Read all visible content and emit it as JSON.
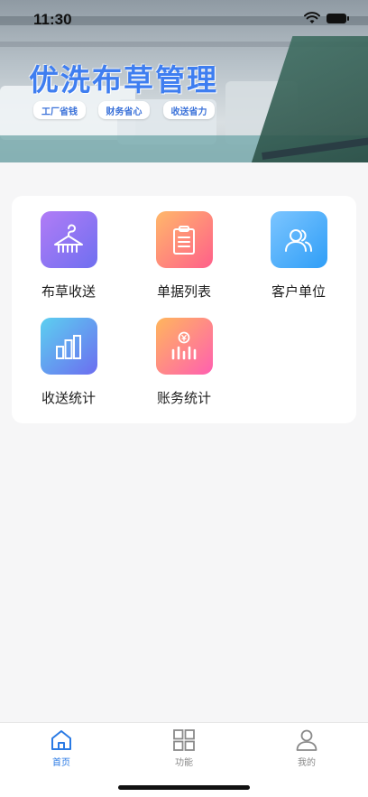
{
  "status_bar": {
    "time": "11:30"
  },
  "banner": {
    "title": "优洗布草管理",
    "tags": [
      "工厂省钱",
      "财务省心",
      "收送省力"
    ]
  },
  "functions": [
    {
      "label": "布草收送",
      "icon": "hanger-icon",
      "gradient": [
        "#b17cf6",
        "#6f6ff0"
      ]
    },
    {
      "label": "单据列表",
      "icon": "clipboard-icon",
      "gradient": [
        "#ffb86a",
        "#ff5f8a"
      ]
    },
    {
      "label": "客户单位",
      "icon": "users-icon",
      "gradient": [
        "#7cc5ff",
        "#2f9ef7"
      ]
    },
    {
      "label": "收送统计",
      "icon": "bar-chart-icon",
      "gradient": [
        "#5cd0f0",
        "#6c6df0"
      ]
    },
    {
      "label": "账务统计",
      "icon": "finance-chart-icon",
      "gradient": [
        "#ffb65c",
        "#ff5fb0"
      ]
    }
  ],
  "tabbar": {
    "items": [
      {
        "label": "首页",
        "icon": "home-icon",
        "active": true
      },
      {
        "label": "功能",
        "icon": "grid-icon",
        "active": false
      },
      {
        "label": "我的",
        "icon": "person-icon",
        "active": false
      }
    ],
    "active_color": "#2a7ae4",
    "inactive_color": "#8a8a8a"
  }
}
